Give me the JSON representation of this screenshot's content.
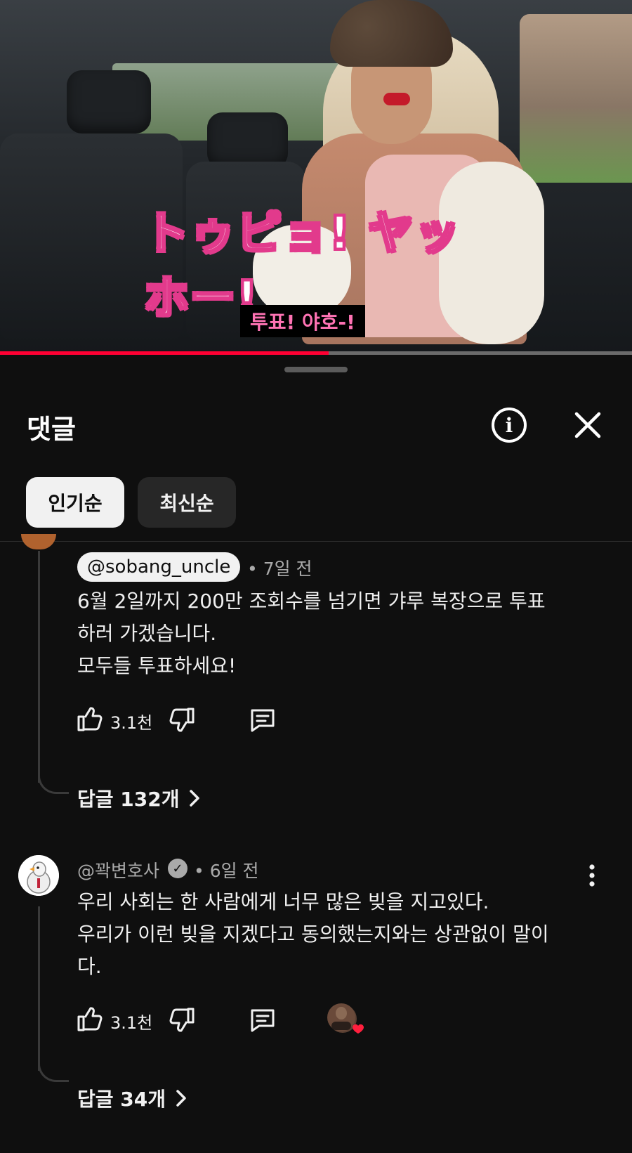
{
  "video": {
    "caption_japanese": "トゥピョ! ヤッホー!",
    "caption_korean": "투표! 야호-!",
    "progress_fraction": 0.52
  },
  "sheet": {
    "title": "댓글",
    "info_icon": "info-circle-icon",
    "close_icon": "close-icon"
  },
  "sort_chips": [
    {
      "label": "인기순",
      "active": true
    },
    {
      "label": "최신순",
      "active": false
    }
  ],
  "comments": [
    {
      "handle": "@sobang_uncle",
      "time": "• 7일 전",
      "text": "6월 2일까지 200만 조회수를 넘기면 갸루 복장으로 투표\n하러 가겠습니다.\n모두들 투표하세요!",
      "likes": "3.1천",
      "replies": "답글 132개"
    },
    {
      "handle": "@꽉변호사",
      "verified": true,
      "time": "• 6일 전",
      "text": "우리 사회는 한 사람에게 너무 많은 빚을 지고있다.\n우리가 이런 빚을 지겠다고 동의했는지와는 상관없이 말이\n다.",
      "likes": "3.1천",
      "creator_hearted": true,
      "replies": "답글 34개"
    }
  ]
}
